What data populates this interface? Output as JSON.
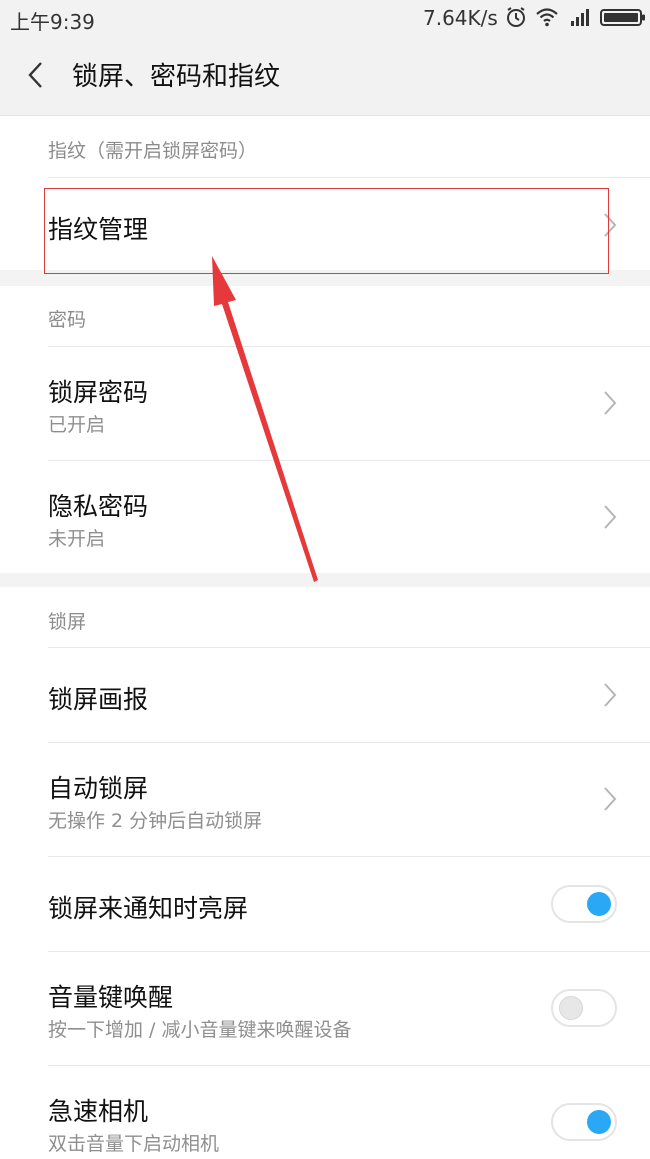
{
  "status_bar": {
    "time": "上午9:39",
    "network_speed": "7.64K/s",
    "icons": [
      "alarm-icon",
      "wifi-icon",
      "signal-icon",
      "battery-icon"
    ]
  },
  "header": {
    "back_icon": "chevron-left-icon",
    "title": "锁屏、密码和指纹"
  },
  "sections": {
    "fingerprint": {
      "label": "指纹（需开启锁屏密码）",
      "items": [
        {
          "title": "指纹管理"
        }
      ]
    },
    "password": {
      "label": "密码",
      "items": [
        {
          "title": "锁屏密码",
          "subtitle": "已开启"
        },
        {
          "title": "隐私密码",
          "subtitle": "未开启"
        }
      ]
    },
    "lockscreen": {
      "label": "锁屏",
      "items": [
        {
          "title": "锁屏画报"
        },
        {
          "title": "自动锁屏",
          "subtitle": "无操作 2 分钟后自动锁屏"
        },
        {
          "title": "锁屏来通知时亮屏",
          "toggle": true
        },
        {
          "title": "音量键唤醒",
          "subtitle": "按一下增加 / 减小音量键来唤醒设备",
          "toggle": false
        },
        {
          "title": "急速相机",
          "subtitle": "双击音量下启动相机",
          "toggle": true
        }
      ]
    }
  },
  "colors": {
    "accent": "#2aa8f5",
    "annotation": "#e03a3a"
  }
}
